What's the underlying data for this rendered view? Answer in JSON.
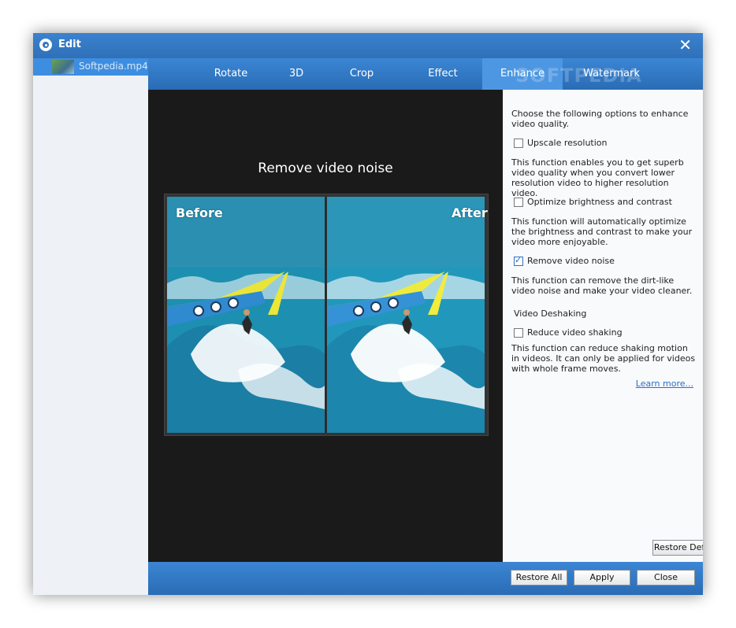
{
  "window": {
    "title": "Edit",
    "close_icon": "close-icon"
  },
  "sidebar": {
    "file_name": "Softpedia.mp4"
  },
  "tabs": [
    {
      "label": "Rotate"
    },
    {
      "label": "3D"
    },
    {
      "label": "Crop"
    },
    {
      "label": "Effect"
    },
    {
      "label": "Enhance",
      "active": true
    },
    {
      "label": "Watermark"
    }
  ],
  "watermark_logo": "SOFTPEDIA",
  "preview": {
    "title": "Remove video noise",
    "before_label": "Before",
    "after_label": "After"
  },
  "options": {
    "intro": "Choose the following options to enhance video quality.",
    "upscale_label": "Upscale resolution",
    "upscale_checked": false,
    "upscale_desc": "This function enables you to get superb video quality when you convert lower resolution video to higher resolution video.",
    "brightness_label": "Optimize brightness and contrast",
    "brightness_checked": false,
    "brightness_desc": "This function will automatically optimize the brightness and contrast to make your video more enjoyable.",
    "noise_label": "Remove video noise",
    "noise_checked": true,
    "noise_desc": "This function can remove the dirt-like video noise and make your video cleaner.",
    "deshake_section": "Video Deshaking",
    "deshake_label": "Reduce video shaking",
    "deshake_checked": false,
    "deshake_desc": "This function can reduce shaking motion in videos. It can only be applied for videos with whole frame moves.",
    "learn_more": "Learn more...",
    "restore_defaults": "Restore Defaults"
  },
  "footer": {
    "restore_all": "Restore All",
    "apply": "Apply",
    "close": "Close"
  },
  "colors": {
    "accent": "#2f74c0",
    "preview_bg": "#1a1a1a",
    "link": "#2a6fc5"
  }
}
